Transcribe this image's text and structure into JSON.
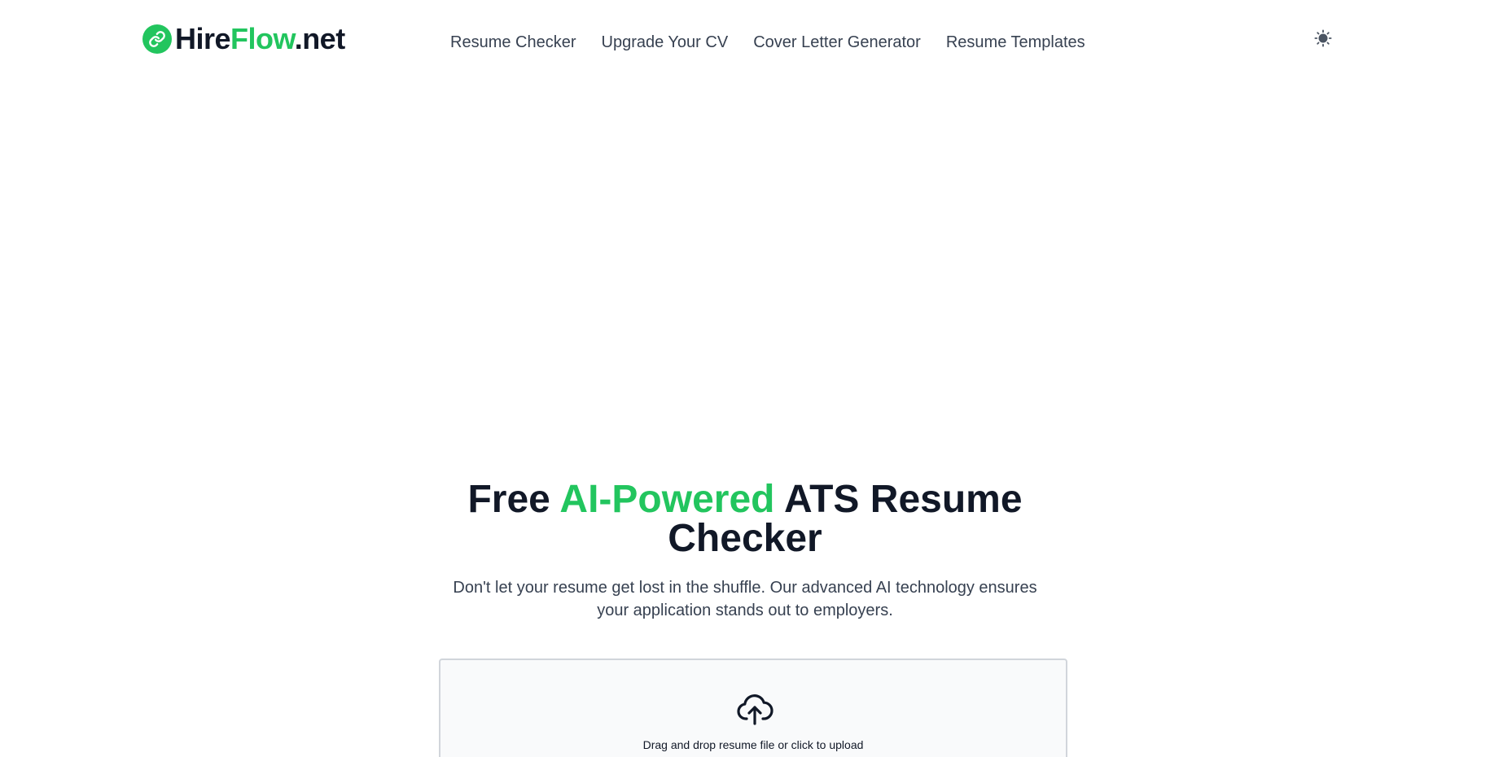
{
  "header": {
    "logo": {
      "part1": "Hire",
      "part2": "Flow",
      "part3": ".net",
      "icon": "link-icon"
    },
    "nav": [
      {
        "label": "Resume Checker"
      },
      {
        "label": "Upgrade Your CV"
      },
      {
        "label": "Cover Letter Generator"
      },
      {
        "label": "Resume Templates"
      }
    ],
    "theme_toggle_icon": "sun-icon"
  },
  "hero": {
    "title_part1": "Free ",
    "title_accent": "AI-Powered",
    "title_part2": " ATS Resume Checker",
    "subtitle": "Don't let your resume get lost in the shuffle. Our advanced AI technology ensures your application stands out to employers."
  },
  "upload": {
    "icon": "cloud-upload-icon",
    "label": "Drag and drop resume file or click to upload"
  },
  "colors": {
    "accent": "#22c55e",
    "text": "#111827",
    "muted": "#374151",
    "upload_bg": "#f9fafb",
    "upload_border": "#d1d5db"
  }
}
